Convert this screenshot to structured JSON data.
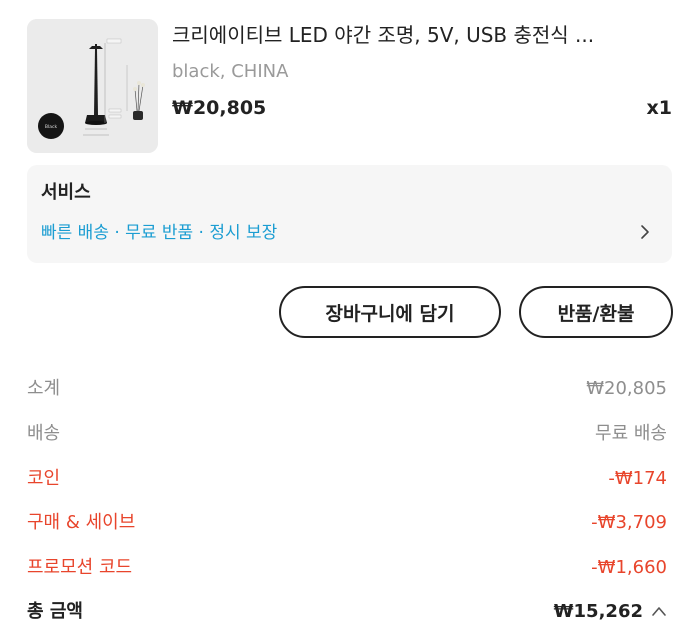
{
  "product": {
    "title": "크리에이티브 LED 야간 조명, 5V, USB 충전식 ...",
    "variant": "black, CHINA",
    "price": "₩20,805",
    "quantity": "x1",
    "thumb_badge": "Black"
  },
  "service": {
    "title": "서비스",
    "description": "빠른 배송 · 무료 반품 · 정시 보장"
  },
  "actions": {
    "add_to_cart": "장바구니에 담기",
    "return_refund": "반품/환불"
  },
  "summary": {
    "subtotal_label": "소계",
    "subtotal_value": "₩20,805",
    "shipping_label": "배송",
    "shipping_value": "무료 배송",
    "coin_label": "코인",
    "coin_value": "-₩174",
    "buy_save_label": "구매 & 세이브",
    "buy_save_value": "-₩3,709",
    "promo_label": "프로모션 코드",
    "promo_value": "-₩1,660",
    "total_label": "총 금액",
    "total_value": "₩15,262"
  },
  "colors": {
    "accent_blue": "#1b9dd2",
    "discount_red": "#e8452c",
    "muted_gray": "#8e8e8e"
  }
}
